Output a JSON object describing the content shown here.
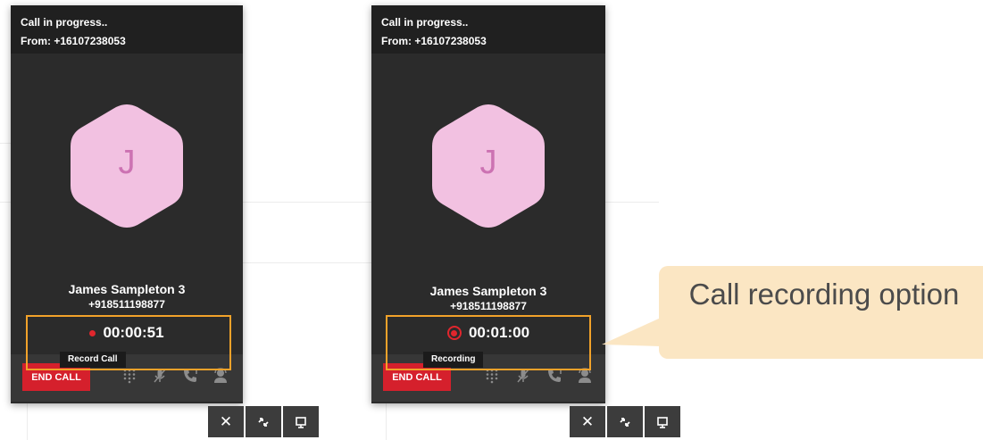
{
  "panels": [
    {
      "status": "Call in progress..",
      "from": "From: +16107238053",
      "avatar_letter": "J",
      "caller_name": "James Sampleton 3",
      "caller_number": "+918511198877",
      "timer": "00:00:51",
      "recording_state": "not-recording",
      "tooltip": "Record Call",
      "end_call_label": "END CALL"
    },
    {
      "status": "Call in progress..",
      "from": "From: +16107238053",
      "avatar_letter": "J",
      "caller_name": "James Sampleton 3",
      "caller_number": "+918511198877",
      "timer": "00:01:00",
      "recording_state": "recording",
      "tooltip": "Recording",
      "end_call_label": "END CALL"
    }
  ],
  "control_icons": [
    "dialpad-icon",
    "mute-mic-icon",
    "transfer-call-icon",
    "conference-icon"
  ],
  "mini_toolbar_icons": [
    "close-icon",
    "minimize-icon",
    "popout-icon"
  ],
  "mini_toolbar": {
    "close_glyph": "✕"
  },
  "callout": {
    "text": "Call recording option"
  },
  "colors": {
    "panel_bg": "#2b2b2b",
    "end_call_red": "#d5202c",
    "record_red": "#e0262d",
    "avatar_pink": "#f2c1e1",
    "avatar_letter": "#cc72b2",
    "highlight_orange": "#f1a22a",
    "callout_bg": "#fbe6c3"
  }
}
